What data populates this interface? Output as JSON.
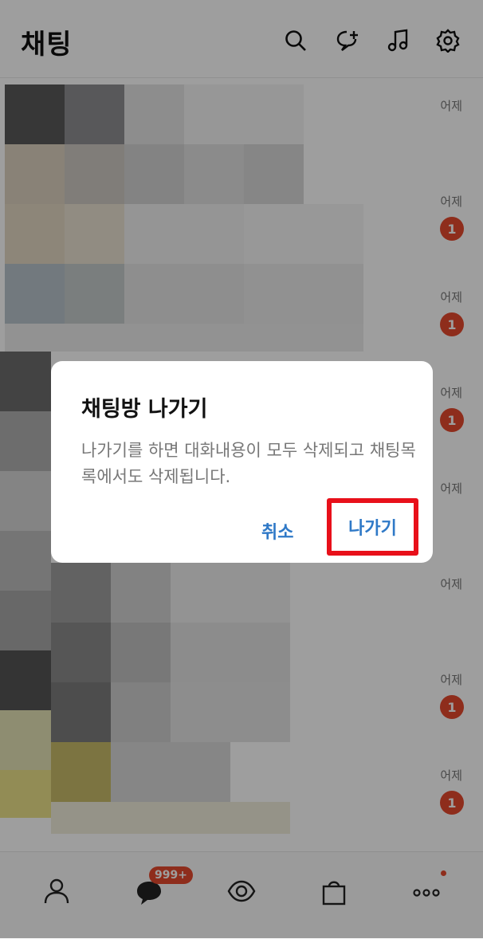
{
  "header": {
    "title": "채팅",
    "icons": [
      "search-icon",
      "new-chat-icon",
      "music-icon",
      "settings-icon"
    ]
  },
  "chat_list": {
    "rows": [
      {
        "time": "어제",
        "unread": ""
      },
      {
        "time": "어제",
        "unread": "1"
      },
      {
        "time": "어제",
        "unread": "1"
      },
      {
        "time": "어제",
        "unread": "1"
      },
      {
        "time": "어제",
        "unread": ""
      },
      {
        "time": "어제",
        "unread": ""
      },
      {
        "time": "어제",
        "unread": "1"
      },
      {
        "time": "어제",
        "unread": "1"
      }
    ]
  },
  "tabbar": {
    "chat_badge": "999+",
    "icons": [
      "friends-icon",
      "chat-icon",
      "view-icon",
      "shopping-icon",
      "more-icon"
    ]
  },
  "dialog": {
    "title": "채팅방 나가기",
    "message": "나가기를 하면 대화내용이 모두 삭제되고 채팅목록에서도 삭제됩니다.",
    "cancel_label": "취소",
    "leave_label": "나가기"
  },
  "colors": {
    "accent": "#2f79c7",
    "badge": "#e64a2e",
    "highlight": "#e8101a"
  }
}
